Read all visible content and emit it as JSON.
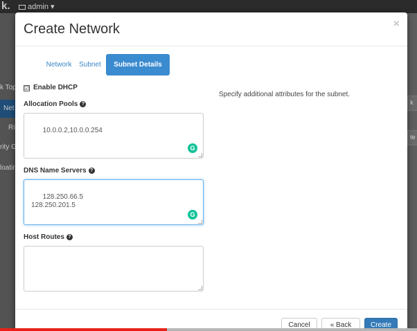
{
  "background": {
    "logo": "k.",
    "project_selector": "admin ▾",
    "sidebar_items": [
      "k Top",
      "Net",
      "Ri",
      "rity G",
      "loatin"
    ],
    "right_buttons": [
      "k",
      "te"
    ]
  },
  "modal": {
    "title": "Create Network",
    "close": "×",
    "tabs": [
      {
        "label": "Network",
        "active": false
      },
      {
        "label": "Subnet",
        "active": false
      },
      {
        "label": "Subnet Details",
        "active": true
      }
    ],
    "enable_dhcp": {
      "label": "Enable DHCP",
      "checked": true,
      "mark": "☑"
    },
    "allocation_pools": {
      "label": "Allocation Pools",
      "value": "10.0.0.2,10.0.0.254"
    },
    "dns_name_servers": {
      "label": "DNS Name Servers",
      "value": "128.250.66.5\n128.250.201.5"
    },
    "host_routes": {
      "label": "Host Routes",
      "value": ""
    },
    "help_text": "Specify additional attributes for the subnet.",
    "help_icon": "?",
    "grammarly_icon": "G",
    "buttons": {
      "cancel": "Cancel",
      "back": "« Back",
      "create": "Create"
    }
  },
  "video_progress": 0.4,
  "colors": {
    "accent": "#3b8bd0",
    "primary_button": "#337ab7",
    "progress": "#e62117",
    "grammarly": "#15c39a"
  }
}
